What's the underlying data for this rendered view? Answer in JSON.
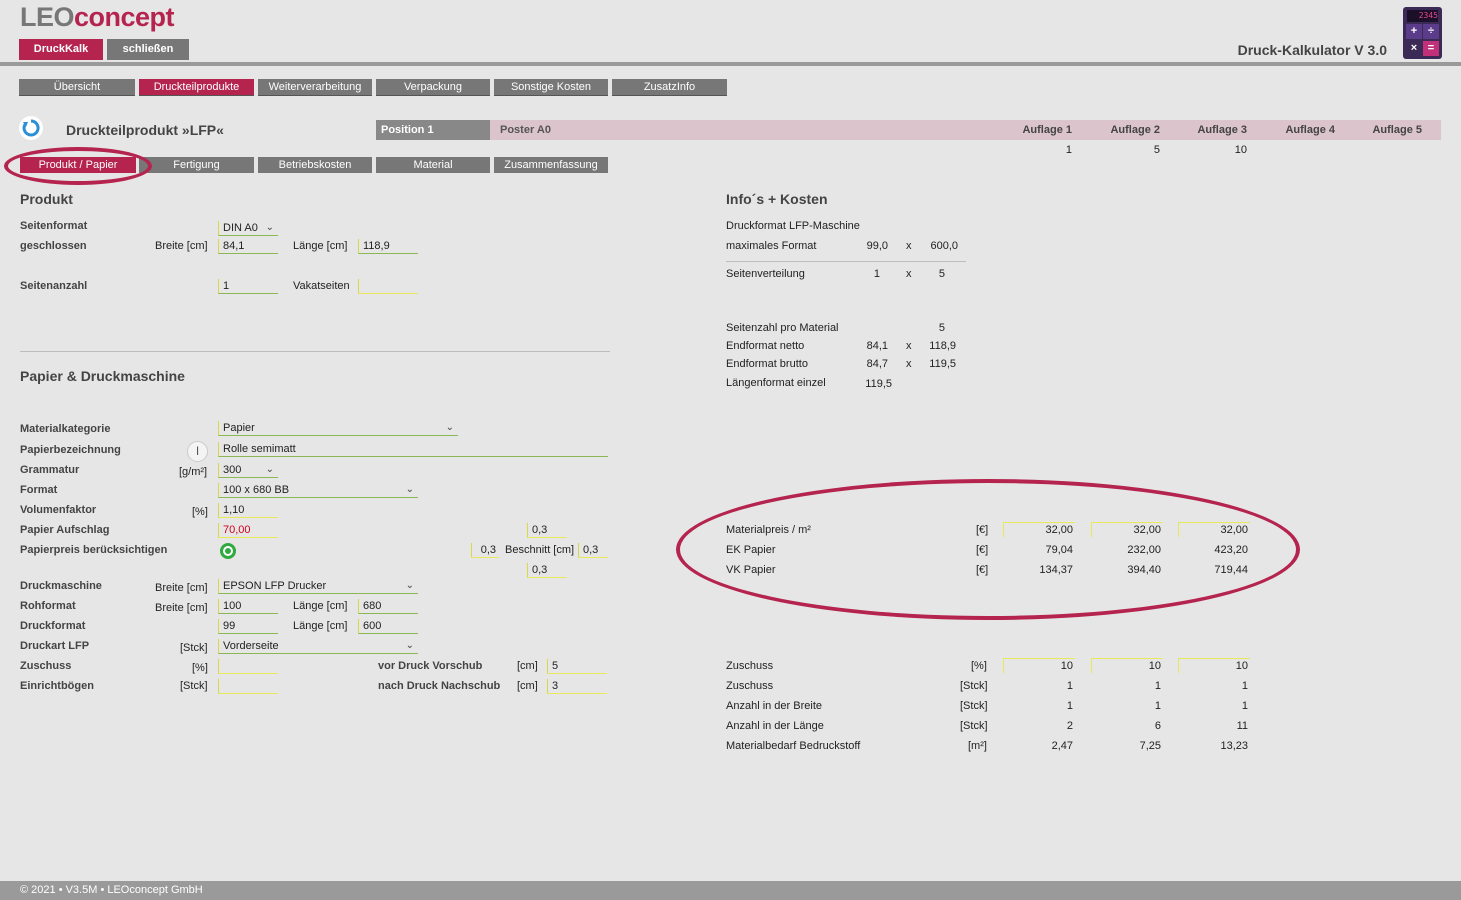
{
  "header": {
    "logo_part1": "LEO",
    "logo_part2": "concept",
    "btn_druckkalk": "DruckKalk",
    "btn_close": "schließen",
    "app_title": "Druck-Kalkulator V 3.0",
    "calc_display": "2345"
  },
  "main_tabs": [
    "Übersicht",
    "Druckteilprodukte",
    "Weiterverarbeitung",
    "Verpackung",
    "Sonstige Kosten",
    "ZusatzInfo"
  ],
  "product": {
    "title": "Druckteilprodukt »LFP«",
    "position_label": "Position 1",
    "position_name": "Poster A0",
    "auflage_headers": [
      "Auflage 1",
      "Auflage 2",
      "Auflage 3",
      "Auflage 4",
      "Auflage 5"
    ],
    "auflage_values": [
      "1",
      "5",
      "10",
      "",
      ""
    ]
  },
  "sub_tabs": [
    "Produkt / Papier",
    "Fertigung",
    "Betriebskosten",
    "Material",
    "Zusammenfassung"
  ],
  "produkt": {
    "section": "Produkt",
    "seitenformat_label": "Seitenformat",
    "seitenformat_value": "DIN A0",
    "geschlossen_label": "geschlossen",
    "breite_label": "Breite [cm]",
    "breite_value": "84,1",
    "laenge_label": "Länge [cm]",
    "laenge_value": "118,9",
    "seitenanzahl_label": "Seitenanzahl",
    "seitenanzahl_value": "1",
    "vakatseiten_label": "Vakatseiten"
  },
  "papier": {
    "section": "Papier & Druckmaschine",
    "materialkategorie_label": "Materialkategorie",
    "materialkategorie_value": "Papier",
    "papierbezeichnung_label": "Papierbezeichnung",
    "papierbezeichnung_value": "Rolle semimatt",
    "grammatur_label": "Grammatur",
    "grammatur_unit": "[g/m²]",
    "grammatur_value": "300",
    "format_label": "Format",
    "format_value": "100 x 680 BB",
    "volumenfaktor_label": "Volumenfaktor",
    "volumenfaktor_unit": "[%]",
    "volumenfaktor_value": "1,10",
    "aufschlag_label": "Papier Aufschlag",
    "aufschlag_value": "70,00",
    "beruecksichtigen_label": "Papierpreis berücksichtigen",
    "beschnitt_label": "Beschnitt [cm]",
    "beschnitt_top": "0,3",
    "beschnitt_left": "0,3",
    "beschnitt_right": "0,3",
    "beschnitt_bottom": "0,3",
    "druckmaschine_label": "Druckmaschine",
    "druckmaschine_breite_label": "Breite [cm]",
    "druckmaschine_value": "EPSON LFP Drucker",
    "rohformat_label": "Rohformat",
    "rohformat_breite_label": "Breite [cm]",
    "rohformat_breite": "100",
    "rohformat_laenge_label": "Länge [cm]",
    "rohformat_laenge": "680",
    "druckformat_label": "Druckformat",
    "druckformat_breite": "99",
    "druckformat_laenge_label": "Länge [cm]",
    "druckformat_laenge": "600",
    "druckart_label": "Druckart LFP",
    "druckart_unit": "[Stck]",
    "druckart_value": "Vorderseite",
    "zuschuss_label": "Zuschuss",
    "zuschuss_unit": "[%]",
    "vordruck_label": "vor Druck Vorschub",
    "vordruck_unit": "[cm]",
    "vordruck_value": "5",
    "einricht_label": "Einrichtbögen",
    "einricht_unit": "[Stck]",
    "nachdruck_label": "nach Druck Nachschub",
    "nachdruck_unit": "[cm]",
    "nachdruck_value": "3"
  },
  "info": {
    "section": "Info´s + Kosten",
    "druckformat_label": "Druckformat LFP-Maschine",
    "maxformat_label": "maximales Format",
    "maxformat_w": "99,0",
    "maxformat_x": "x",
    "maxformat_h": "600,0",
    "seitenverteilung_label": "Seitenverteilung",
    "seitenverteilung_a": "1",
    "seitenverteilung_x": "x",
    "seitenverteilung_b": "5",
    "seitenzahl_label": "Seitenzahl pro Material",
    "seitenzahl_value": "5",
    "netto_label": "Endformat netto",
    "netto_w": "84,1",
    "netto_x": "x",
    "netto_h": "118,9",
    "brutto_label": "Endformat brutto",
    "brutto_w": "84,7",
    "brutto_x": "x",
    "brutto_h": "119,5",
    "laengen_label": "Längenformat einzel",
    "laengen_value": "119,5"
  },
  "costs": [
    {
      "label": "Materialpreis / m²",
      "unit": "[€]",
      "v1": "32,00",
      "v2": "32,00",
      "v3": "32,00"
    },
    {
      "label": "EK Papier",
      "unit": "[€]",
      "v1": "79,04",
      "v2": "232,00",
      "v3": "423,20"
    },
    {
      "label": "VK Papier",
      "unit": "[€]",
      "v1": "134,37",
      "v2": "394,40",
      "v3": "719,44"
    }
  ],
  "material": [
    {
      "label": "Zuschuss",
      "unit": "[%]",
      "v1": "10",
      "v2": "10",
      "v3": "10"
    },
    {
      "label": "Zuschuss",
      "unit": "[Stck]",
      "v1": "1",
      "v2": "1",
      "v3": "1"
    },
    {
      "label": "Anzahl in der Breite",
      "unit": "[Stck]",
      "v1": "1",
      "v2": "1",
      "v3": "1"
    },
    {
      "label": "Anzahl in der Länge",
      "unit": "[Stck]",
      "v1": "2",
      "v2": "6",
      "v3": "11"
    },
    {
      "label": "Materialbedarf Bedruckstoff",
      "unit": "[m²]",
      "v1": "2,47",
      "v2": "7,25",
      "v3": "13,23"
    }
  ],
  "footer": "© 2021 • V3.5M • LEOconcept GmbH",
  "colors": {
    "accent": "#b5244f",
    "grey": "#777777",
    "background": "#e6e6e6"
  }
}
